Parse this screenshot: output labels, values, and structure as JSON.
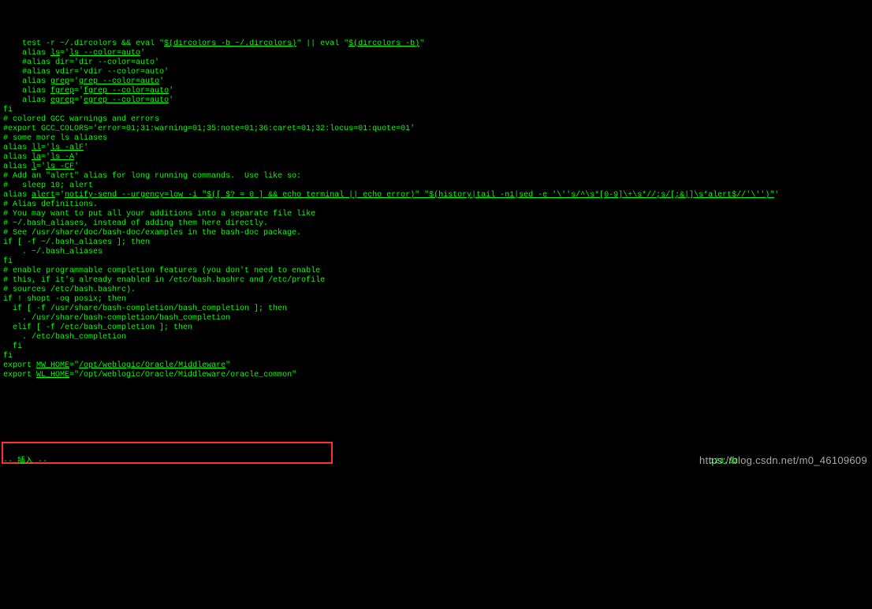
{
  "terminal": {
    "lines": [
      {
        "pre": "    test -r ~/.dircolors && eval \"",
        "u": "$(dircolors -b ~/.dircolors)",
        "post": "\" || eval \"",
        "u2": "$(dircolors -b)",
        "post2": "\""
      },
      {
        "pre": "    alias ",
        "u": "ls",
        "post": "='",
        "u2": "ls --color=auto",
        "post2": "'"
      },
      {
        "pre": "    #alias dir='dir --color=auto'"
      },
      {
        "pre": "    #alias vdir='vdir --color=auto'"
      },
      {
        "pre": ""
      },
      {
        "pre": "    alias ",
        "u": "grep",
        "post": "='",
        "u2": "grep --color=auto",
        "post2": "'"
      },
      {
        "pre": "    alias ",
        "u": "fgrep",
        "post": "='",
        "u2": "fgrep --color=auto",
        "post2": "'"
      },
      {
        "pre": "    alias ",
        "u": "egrep",
        "post": "='",
        "u2": "egrep --color=auto",
        "post2": "'"
      },
      {
        "pre": "fi"
      },
      {
        "pre": ""
      },
      {
        "pre": "# colored GCC warnings and errors"
      },
      {
        "pre": "#export GCC_COLORS='error=01;31:warning=01;35:note=01;36:caret=01;32:locus=01:quote=01'"
      },
      {
        "pre": ""
      },
      {
        "pre": "# some more ls aliases"
      },
      {
        "pre": "alias ",
        "u": "ll",
        "post": "='",
        "u2": "ls -alF",
        "post2": "'"
      },
      {
        "pre": "alias ",
        "u": "la",
        "post": "='",
        "u2": "ls -A",
        "post2": "'"
      },
      {
        "pre": "alias ",
        "u": "l",
        "post": "='",
        "u2": "ls -CF",
        "post2": "'"
      },
      {
        "pre": ""
      },
      {
        "pre": "# Add an \"alert\" alias for long running commands.  Use like so:"
      },
      {
        "pre": "#   sleep 10; alert"
      },
      {
        "pre": "alias ",
        "u": "alert",
        "post": "='",
        "u2": "notify-send --urgency=low -i \"$([ $? = 0 ] && echo terminal || echo error)\" \"$(history|tail -n1|sed -e '\\''s/^\\s*[0-9]\\+\\s*//;s/[;&|]\\s*alert$//'\\'')\"",
        "post2": "'"
      },
      {
        "pre": ""
      },
      {
        "pre": "# Alias definitions."
      },
      {
        "pre": "# You may want to put all your additions into a separate file like"
      },
      {
        "pre": "# ~/.bash_aliases, instead of adding them here directly."
      },
      {
        "pre": "# See /usr/share/doc/bash-doc/examples in the bash-doc package."
      },
      {
        "pre": ""
      },
      {
        "pre": "if [ -f ~/.bash_aliases ]; then"
      },
      {
        "pre": "    . ~/.bash_aliases"
      },
      {
        "pre": "fi"
      },
      {
        "pre": ""
      },
      {
        "pre": "# enable programmable completion features (you don't need to enable"
      },
      {
        "pre": "# this, if it's already enabled in /etc/bash.bashrc and /etc/profile"
      },
      {
        "pre": "# sources /etc/bash.bashrc)."
      },
      {
        "pre": "if ! shopt -oq posix; then"
      },
      {
        "pre": "  if [ -f /usr/share/bash-completion/bash_completion ]; then"
      },
      {
        "pre": "    . /usr/share/bash-completion/bash_completion"
      },
      {
        "pre": "  elif [ -f /etc/bash_completion ]; then"
      },
      {
        "pre": "    . /etc/bash_completion"
      },
      {
        "pre": "  fi"
      },
      {
        "pre": "fi"
      },
      {
        "pre": ""
      },
      {
        "pre": ""
      },
      {
        "pre": ""
      },
      {
        "pre": ""
      },
      {
        "pre": "export ",
        "u": "MW_HOME",
        "post": "=\"",
        "u2": "/opt/weblogic/Oracle/Middleware",
        "post2": "\""
      },
      {
        "pre": ""
      },
      {
        "pre": "export ",
        "u": "WL_HOME",
        "post": "=\"/opt/weblogic/Oracle/Middleware/oracle_common\""
      }
    ]
  },
  "status": {
    "mode": "-- 插入 --",
    "pos": "123,52"
  },
  "watermark": "https://blog.csdn.net/m0_46109609"
}
